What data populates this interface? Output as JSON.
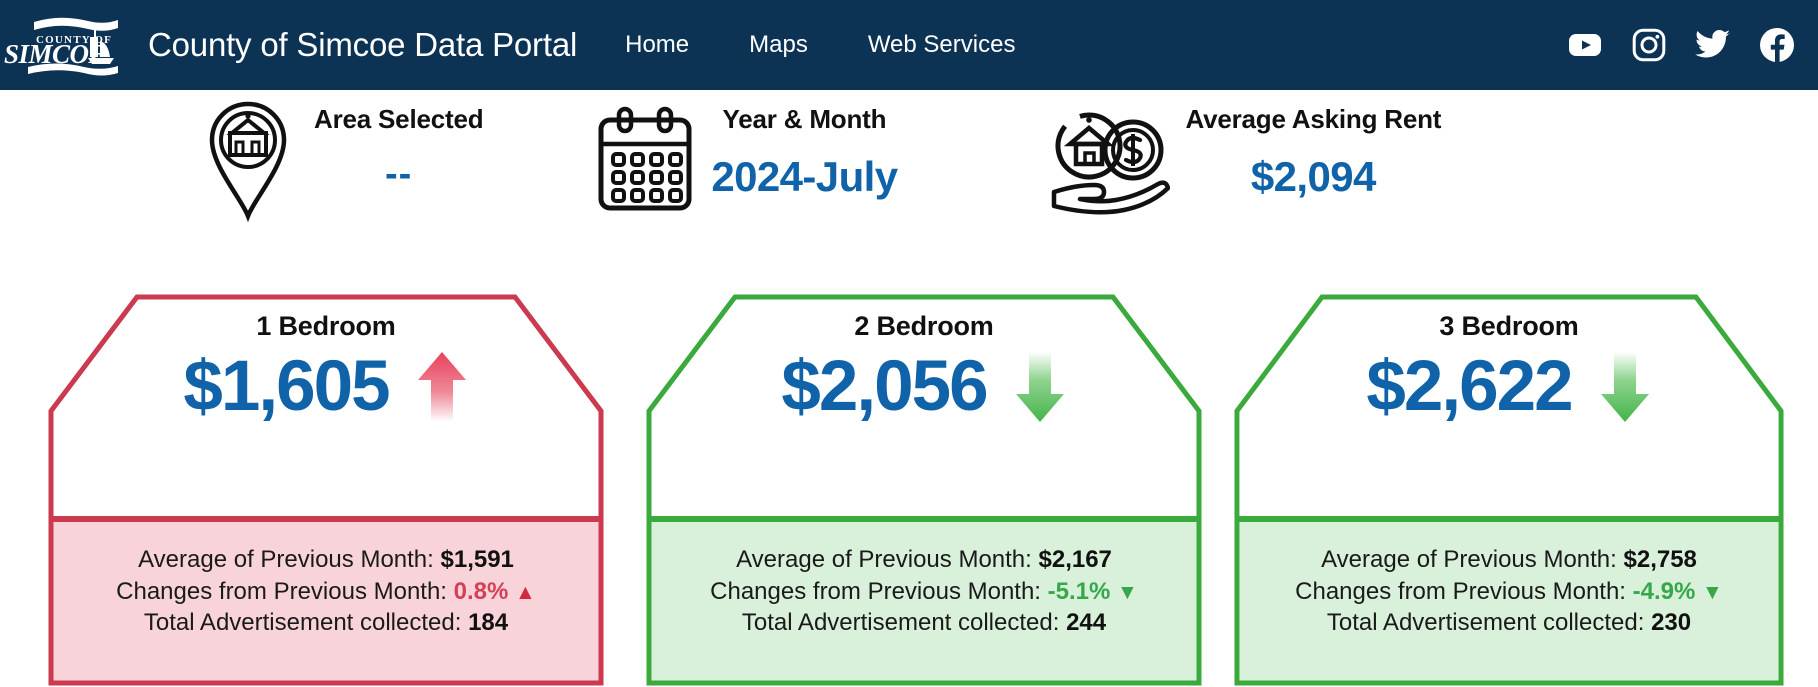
{
  "header": {
    "logo_line1": "COUNTY OF",
    "logo_line2": "SIMCOE",
    "logo_name": "county-of-simcoe-logo",
    "title": "County of Simcoe Data Portal",
    "nav": [
      {
        "label": "Home",
        "name": "nav-item-home"
      },
      {
        "label": "Maps",
        "name": "nav-item-maps"
      },
      {
        "label": "Web Services",
        "name": "nav-item-web-services"
      }
    ],
    "social": [
      {
        "name": "youtube-icon",
        "label": "YouTube"
      },
      {
        "name": "instagram-icon",
        "label": "Instagram"
      },
      {
        "name": "twitter-icon",
        "label": "Twitter"
      },
      {
        "name": "facebook-icon",
        "label": "Facebook"
      }
    ],
    "background_color": "#0c3254"
  },
  "kpis": [
    {
      "name": "kpi-area-selected",
      "icon": "map-pin-building-icon",
      "label": "Area Selected",
      "value": "--"
    },
    {
      "name": "kpi-year-month",
      "icon": "calendar-icon",
      "label": "Year & Month",
      "value": "2024-July"
    },
    {
      "name": "kpi-average-asking-rent",
      "icon": "hand-house-coin-icon",
      "label": "Average Asking Rent",
      "value": "$2,094"
    }
  ],
  "cards": [
    {
      "name": "card-1-bedroom",
      "title": "1 Bedroom",
      "value": "$1,605",
      "trend": "up",
      "arrow_icon": "arrow-up-icon",
      "accent_color": "#cc3a4f",
      "fill_color": "#f8d4da",
      "prev_label": "Average of Previous Month:",
      "prev_value": "$1,591",
      "change_label": "Changes from Previous Month:",
      "change_value": "0.8%",
      "change_marker": "▲",
      "total_label": "Total Advertisement collected:",
      "total_value": "184"
    },
    {
      "name": "card-2-bedroom",
      "title": "2 Bedroom",
      "value": "$2,056",
      "trend": "down",
      "arrow_icon": "arrow-down-icon",
      "accent_color": "#3aaa3c",
      "fill_color": "#d9f0da",
      "prev_label": "Average of Previous Month:",
      "prev_value": "$2,167",
      "change_label": "Changes from Previous Month:",
      "change_value": "-5.1%",
      "change_marker": "▼",
      "total_label": "Total Advertisement collected:",
      "total_value": "244"
    },
    {
      "name": "card-3-bedroom",
      "title": "3 Bedroom",
      "value": "$2,622",
      "trend": "down",
      "arrow_icon": "arrow-down-icon",
      "accent_color": "#3aaa3c",
      "fill_color": "#d9f0da",
      "prev_label": "Average of Previous Month:",
      "prev_value": "$2,758",
      "change_label": "Changes from Previous Month:",
      "change_value": "-4.9%",
      "change_marker": "▼",
      "total_label": "Total Advertisement collected:",
      "total_value": "230"
    }
  ],
  "colors": {
    "navy": "#0c3254",
    "value_blue": "#1063a8",
    "red": "#cc3a4f",
    "green": "#3aaa3c"
  }
}
